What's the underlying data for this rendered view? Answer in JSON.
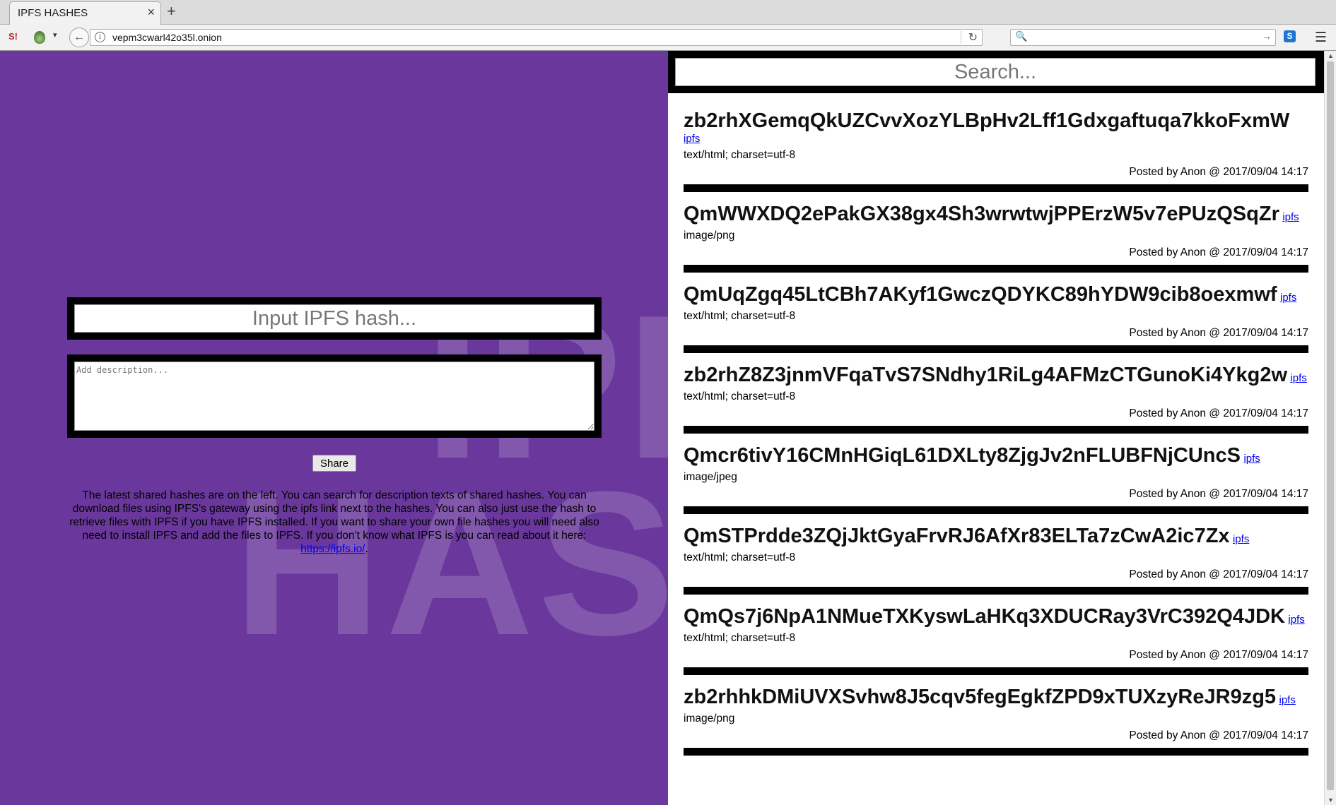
{
  "browser": {
    "tab_title": "IPFS HASHES",
    "tab_close": "×",
    "new_tab": "+",
    "url": "vepm3cwarl42o35l.onion",
    "back": "←",
    "reload": "↻",
    "menu": "☰",
    "search_icon": "🔍",
    "search_go": "→",
    "ext_label": "S!",
    "sync_label": "S",
    "onion_arrow": "▾",
    "info": "i"
  },
  "page": {
    "background_color": "#6a389c",
    "watermark": [
      "IPFS",
      "HASHES"
    ],
    "hash_input": {
      "placeholder": "Input IPFS hash..."
    },
    "description": {
      "placeholder": "Add description..."
    },
    "share_label": "Share",
    "info_text": "The latest shared hashes are on the left. You can search for description texts of shared hashes. You can download files using IPFS's gateway using the ipfs link next to the hashes. You can also just use the hash to retrieve files with IPFS if you have IPFS installed. If you want to share your own file hashes you will need also need to install IPFS and add the files to IPFS. If you don't know what IPFS is you can read about it here: ",
    "info_link": "https://ipfs.io/",
    "info_end": ".",
    "search": {
      "placeholder": "Search..."
    },
    "posts": [
      {
        "hash": "zb2rhXGemqQkUZCvvXozYLBpHv2Lff1Gdxgaftuqa7kkoFxmW",
        "link": "ipfs",
        "mime": "text/html; charset=utf-8",
        "posted": "Posted by Anon @ 2017/09/04 14:17"
      },
      {
        "hash": "QmWWXDQ2ePakGX38gx4Sh3wrwtwjPPErzW5v7ePUzQSqZr",
        "link": "ipfs",
        "mime": "image/png",
        "posted": "Posted by Anon @ 2017/09/04 14:17"
      },
      {
        "hash": "QmUqZgq45LtCBh7AKyf1GwczQDYKC89hYDW9cib8oexmwf",
        "link": "ipfs",
        "mime": "text/html; charset=utf-8",
        "posted": "Posted by Anon @ 2017/09/04 14:17"
      },
      {
        "hash": "zb2rhZ8Z3jnmVFqaTvS7SNdhy1RiLg4AFMzCTGunoKi4Ykg2w",
        "link": "ipfs",
        "mime": "text/html; charset=utf-8",
        "posted": "Posted by Anon @ 2017/09/04 14:17"
      },
      {
        "hash": "Qmcr6tivY16CMnHGiqL61DXLty8ZjgJv2nFLUBFNjCUncS",
        "link": "ipfs",
        "mime": "image/jpeg",
        "posted": "Posted by Anon @ 2017/09/04 14:17"
      },
      {
        "hash": "QmSTPrdde3ZQjJktGyaFrvRJ6AfXr83ELTa7zCwA2ic7Zx",
        "link": "ipfs",
        "mime": "text/html; charset=utf-8",
        "posted": "Posted by Anon @ 2017/09/04 14:17"
      },
      {
        "hash": "QmQs7j6NpA1NMueTXKyswLaHKq3XDUCRay3VrC392Q4JDK",
        "link": "ipfs",
        "mime": "text/html; charset=utf-8",
        "posted": "Posted by Anon @ 2017/09/04 14:17"
      },
      {
        "hash": "zb2rhhkDMiUVXSvhw8J5cqv5fegEgkfZPD9xTUXzyReJR9zg5",
        "link": "ipfs",
        "mime": "image/png",
        "posted": "Posted by Anon @ 2017/09/04 14:17"
      }
    ]
  }
}
